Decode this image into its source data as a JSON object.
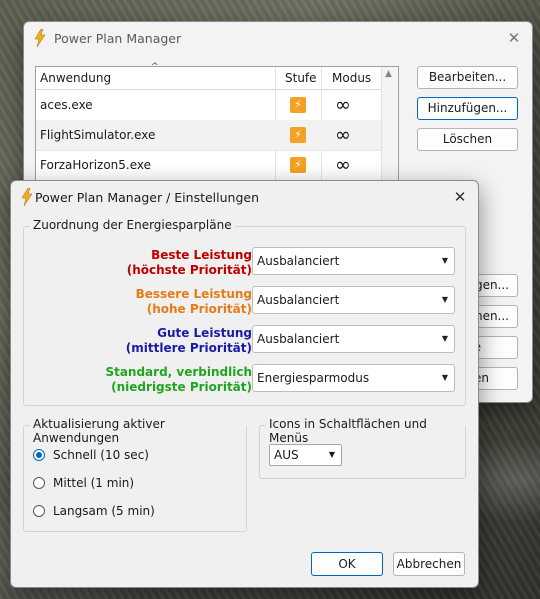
{
  "main_window": {
    "title": "Power Plan Manager",
    "columns": [
      "Anwendung",
      "Stufe",
      "Modus"
    ],
    "rows": [
      {
        "name": "aces.exe"
      },
      {
        "name": "FlightSimulator.exe"
      },
      {
        "name": "ForzaHorizon5.exe"
      }
    ],
    "buttons": {
      "edit": "Bearbeiten...",
      "add": "Hinzufügen...",
      "delete": "Löschen",
      "partial_1": "ngen...",
      "partial_2": "tionen...",
      "partial_3": "e",
      "partial_4": "en"
    }
  },
  "dialog": {
    "title": "Power Plan Manager / Einstellungen",
    "group_plans": "Zuordnung der Energiesparpläne",
    "plans": [
      {
        "line1": "Beste Leistung",
        "line2": "(höchste Priorität)",
        "color": "#c00000",
        "value": "Ausbalanciert"
      },
      {
        "line1": "Bessere Leistung",
        "line2": "(hohe Priorität)",
        "color": "#e77b16",
        "value": "Ausbalanciert"
      },
      {
        "line1": "Gute Leistung",
        "line2": "(mittlere Priorität)",
        "color": "#1a1aa8",
        "value": "Ausbalanciert"
      },
      {
        "line1": "Standard, verbindlich",
        "line2": "(niedrigste Priorität)",
        "color": "#1fa51f",
        "value": "Energiesparmodus"
      }
    ],
    "group_update": "Aktualisierung aktiver Anwendungen",
    "radios": [
      {
        "label": "Schnell (10 sec)",
        "checked": true
      },
      {
        "label": "Mittel (1 min)",
        "checked": false
      },
      {
        "label": "Langsam (5 min)",
        "checked": false
      }
    ],
    "group_icons": "Icons in Schaltflächen und Menüs",
    "icons_value": "AUS",
    "ok": "OK",
    "cancel": "Abbrechen"
  },
  "colors": {
    "accent": "#0067c0",
    "bolt": "#f5a020"
  }
}
